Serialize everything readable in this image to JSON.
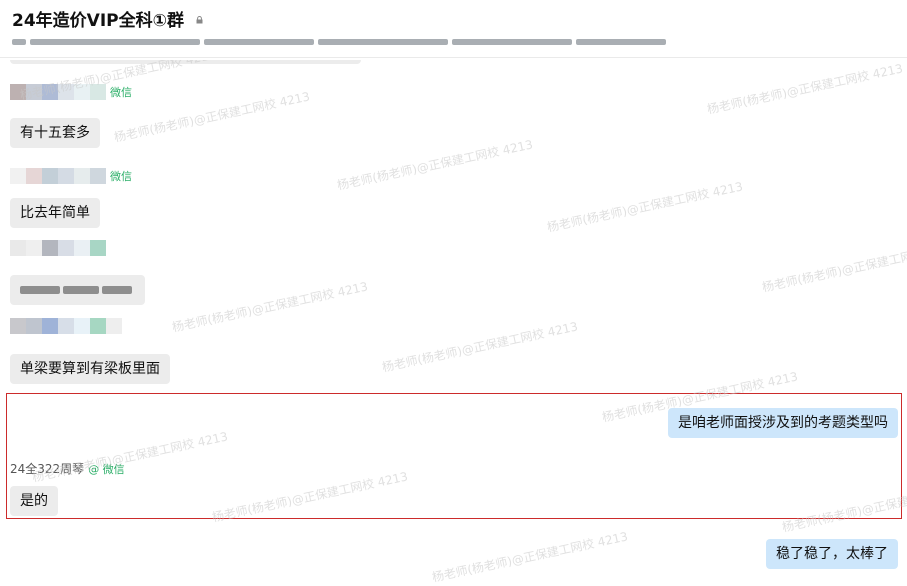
{
  "header": {
    "title": "24年造价VIP全科①群"
  },
  "messages": [
    {
      "id": "m1",
      "sender_tag": "微信",
      "text": "有十五套多"
    },
    {
      "id": "m2",
      "sender_tag": "微信",
      "text": "比去年简单"
    },
    {
      "id": "m3",
      "text_obscured": true
    },
    {
      "id": "m4",
      "text": "单梁要算到有梁板里面"
    },
    {
      "id": "m5",
      "self": true,
      "text": "是咱老师面授涉及到的考题类型吗"
    },
    {
      "id": "m6",
      "sender_name": "24全322周琴",
      "sender_tag": "@ 微信",
      "text": "是的"
    },
    {
      "id": "m7",
      "self": true,
      "text": "稳了稳了，太棒了"
    }
  ],
  "watermark": {
    "text_a": "杨老师(杨老师)@正保建工网校 4213",
    "text_b": "杨老师(杨老师)@正保建工网校 4213"
  },
  "colors": {
    "self_bubble": "#cde6fb",
    "other_bubble": "#ececec",
    "wechat_green": "#2aae67",
    "highlight_border": "#cc2b2b"
  }
}
